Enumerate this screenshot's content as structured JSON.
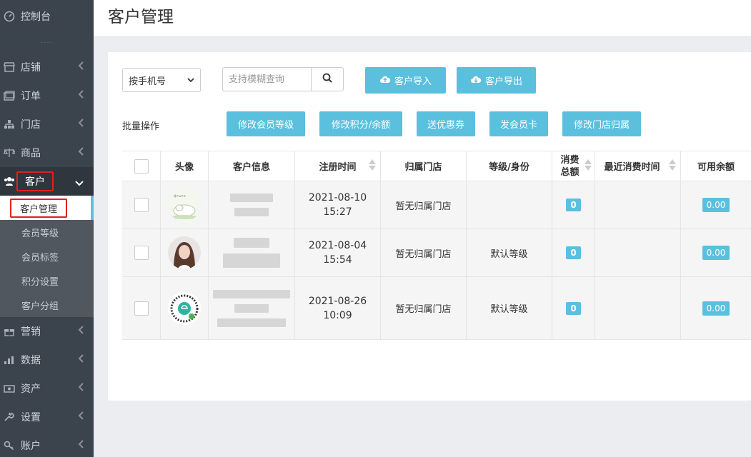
{
  "sidebar": {
    "top": "控制台",
    "sep": "····",
    "items": [
      {
        "label": "店铺",
        "icon": "shop-icon"
      },
      {
        "label": "订单",
        "icon": "order-icon"
      },
      {
        "label": "门店",
        "icon": "store-icon"
      },
      {
        "label": "商品",
        "icon": "goods-icon"
      },
      {
        "label": "客户",
        "icon": "users-icon"
      },
      {
        "label": "营销",
        "icon": "gift-icon"
      },
      {
        "label": "数据",
        "icon": "chart-icon"
      },
      {
        "label": "资产",
        "icon": "wallet-icon"
      },
      {
        "label": "设置",
        "icon": "wrench-icon"
      },
      {
        "label": "账户",
        "icon": "key-icon"
      }
    ],
    "sub_items": [
      "客户管理",
      "会员等级",
      "会员标签",
      "积分设置",
      "客户分组"
    ]
  },
  "header": {
    "title": "客户管理"
  },
  "toolbar": {
    "select_value": "按手机号",
    "search_placeholder": "支持模糊查询",
    "import_label": "客户导入",
    "export_label": "客户导出",
    "batch_label": "批量操作",
    "batch_buttons": [
      "修改会员等级",
      "修改积分/余额",
      "送优惠券",
      "发会员卡",
      "修改门店归属"
    ]
  },
  "table": {
    "headers": [
      "头像",
      "客户信息",
      "注册时间",
      "归属门店",
      "等级/身份",
      "消费总额",
      "最近消费时间",
      "可用余额"
    ],
    "spend_header_line1": "消费",
    "spend_header_line2": "总额",
    "rows": [
      {
        "date": "2021-08-10",
        "time": "15:27",
        "store": "暂无归属门店",
        "level": "",
        "spend": "0",
        "balance": "0.00"
      },
      {
        "date": "2021-08-04",
        "time": "15:54",
        "store": "暂无归属门店",
        "level": "默认等级",
        "spend": "0",
        "balance": "0.00"
      },
      {
        "date": "2021-08-26",
        "time": "10:09",
        "store": "暂无归属门店",
        "level": "默认等级",
        "spend": "0",
        "balance": "0.00"
      }
    ]
  },
  "colors": {
    "sidebar_bg": "#3b434d",
    "accent": "#5bc0de",
    "highlight": "#e02020"
  }
}
